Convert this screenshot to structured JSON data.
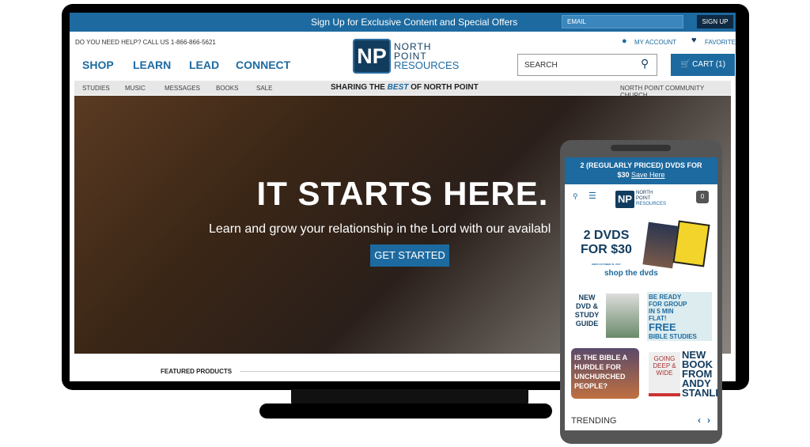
{
  "topbar": {
    "message": "Sign Up for Exclusive Content and Special Offers",
    "email_placeholder": "EMAIL",
    "signup": "SIGN UP"
  },
  "header": {
    "help": "DO YOU NEED HELP? CALL US 1-866-866-5621",
    "account": "MY ACCOUNT",
    "favorites": "FAVORITES",
    "nav": [
      "SHOP",
      "LEARN",
      "LEAD",
      "CONNECT"
    ],
    "logo": {
      "mark": "NP",
      "line1": "NORTH",
      "line2": "POINT",
      "line3": "RESOURCES"
    },
    "search_placeholder": "SEARCH",
    "cart": "CART (1)"
  },
  "subnav": {
    "items": [
      "STUDIES",
      "MUSIC",
      "MESSAGES",
      "BOOKS",
      "SALE"
    ],
    "tagline_pre": "SHARING THE ",
    "tagline_em": "BEST",
    "tagline_post": " OF NORTH POINT",
    "right": "NORTH POINT COMMUNITY CHURCH"
  },
  "hero": {
    "title": "IT STARTS HERE.",
    "subtitle": "Learn and grow your relationship in the Lord with our availabl",
    "cta": "GET STARTED"
  },
  "featured": "FEATURED PRODUCTS",
  "phone": {
    "promo_line1": "2 (REGULARLY PRICED) DVDS FOR",
    "promo_price": "$30",
    "promo_link": "Save Here",
    "cart_count": "0",
    "deal_l1": "2 DVDS",
    "deal_l2": "FOR $30",
    "deal_ends": "ENDS OCTOBER 31, 2017",
    "shop": "shop the dvds",
    "tile1": "NEW DVD & STUDY GUIDE",
    "tile2a": "BE READY FOR GROUP IN 5 MIN FLAT!",
    "tile2b": "FREE",
    "tile2c": "BIBLE STUDIES",
    "tile3": "IS THE BIBLE A HURDLE FOR UNCHURCHED PEOPLE?",
    "tile4": "NEW BOOK FROM ANDY STANLEY",
    "book": "GOING DEEP & WIDE",
    "trending": "TRENDING"
  },
  "colors": {
    "brand": "#1d6aa0",
    "navy": "#123c5e"
  }
}
